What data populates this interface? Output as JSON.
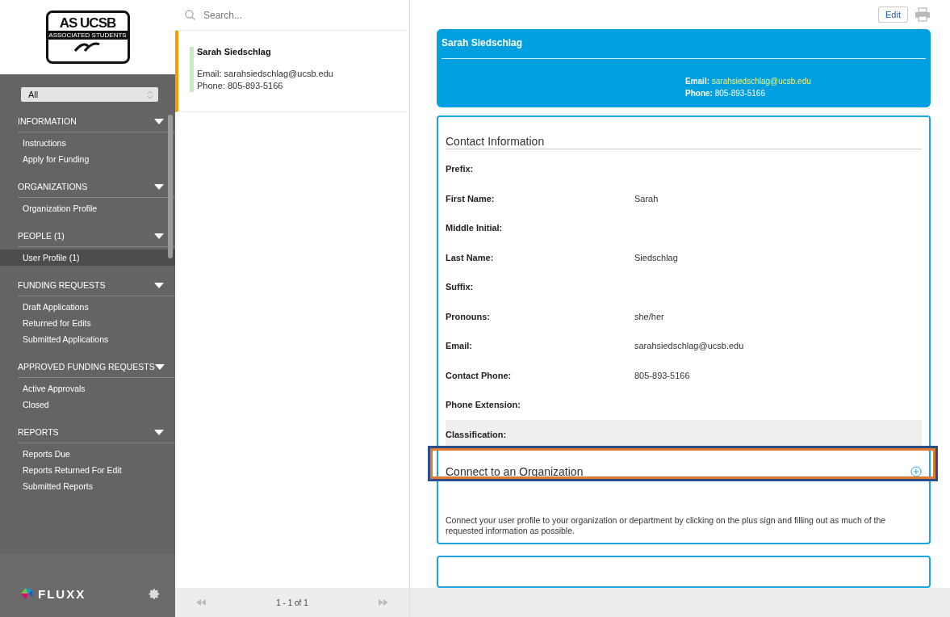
{
  "logo": {
    "title": "AS UCSB",
    "subtitle": "ASSOCIATED STUDENTS"
  },
  "filter": {
    "value": "All"
  },
  "sidebar": {
    "sections": [
      {
        "title": "INFORMATION",
        "expanded": true,
        "items": [
          {
            "label": "Instructions",
            "selected": false
          },
          {
            "label": "Apply for Funding",
            "selected": false
          }
        ]
      },
      {
        "title": "ORGANIZATIONS",
        "expanded": true,
        "items": [
          {
            "label": "Organization Profile",
            "selected": false
          }
        ]
      },
      {
        "title": "PEOPLE (1)",
        "expanded": true,
        "items": [
          {
            "label": "User Profile  (1)",
            "selected": true
          }
        ]
      },
      {
        "title": "FUNDING REQUESTS",
        "expanded": true,
        "items": [
          {
            "label": "Draft Applications",
            "selected": false
          },
          {
            "label": "Returned for Edits",
            "selected": false
          },
          {
            "label": "Submitted Applications",
            "selected": false
          }
        ]
      },
      {
        "title": "APPROVED FUNDING REQUESTS",
        "expanded": true,
        "items": [
          {
            "label": "Active Approvals",
            "selected": false
          },
          {
            "label": "Closed",
            "selected": false
          }
        ]
      },
      {
        "title": "REPORTS",
        "expanded": true,
        "items": [
          {
            "label": "Reports Due",
            "selected": false
          },
          {
            "label": "Reports Returned For Edit",
            "selected": false
          },
          {
            "label": "Submitted Reports",
            "selected": false
          }
        ]
      }
    ]
  },
  "brand": "FLUXX",
  "list": {
    "search_placeholder": "Search...",
    "cards": [
      {
        "name": "Sarah Siedschlag",
        "email": "Email: sarahsiedschlag@ucsb.edu",
        "phone": "Phone: 805-893-5166",
        "selected": true
      }
    ],
    "pager": "1 - 1 of 1"
  },
  "detail": {
    "edit_button": "Edit",
    "header": {
      "name": "Sarah Siedschlag",
      "email_label": "Email:",
      "email": "sarahsiedschlag@ucsb.edu",
      "phone_label": "Phone:",
      "phone": "805-893-5166"
    },
    "contact": {
      "title": "Contact Information",
      "fields": [
        {
          "label": "Prefix:",
          "highlighted": false
        },
        {
          "label": "First Name:",
          "value": "Sarah",
          "highlighted": false
        },
        {
          "label": "Middle Initial:",
          "highlighted": false
        },
        {
          "label": "Last Name:",
          "value": "Siedschlag",
          "highlighted": false
        },
        {
          "label": "Suffix:",
          "highlighted": false
        },
        {
          "label": "Pronouns:",
          "value": "she/her",
          "highlighted": false
        },
        {
          "label": "Email:",
          "value": "sarahsiedschlag@ucsb.edu",
          "highlighted": false
        },
        {
          "label": "Contact Phone:",
          "value": "805-893-5166",
          "highlighted": false
        },
        {
          "label": "Phone Extension:",
          "highlighted": false
        },
        {
          "label": "Classification:",
          "highlighted": true
        }
      ]
    },
    "connect": {
      "title": "Connect to an Organization",
      "highlighted": true,
      "description": "Connect your user profile to your organization or department by clicking on the plus sign and filling out as much of the requested information as possible."
    }
  }
}
